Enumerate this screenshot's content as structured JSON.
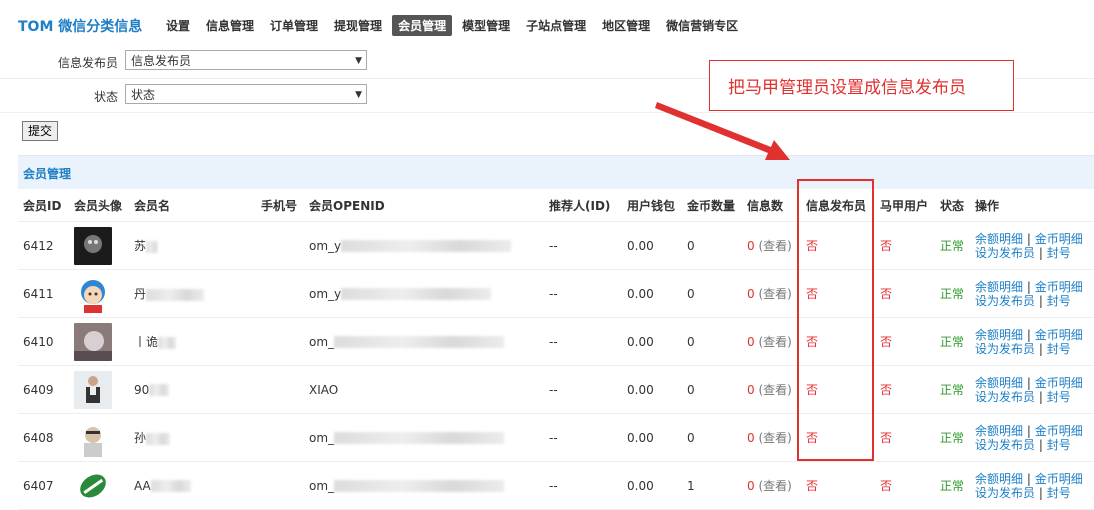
{
  "brand": "TOM 微信分类信息",
  "nav": [
    "设置",
    "信息管理",
    "订单管理",
    "提现管理",
    "会员管理",
    "模型管理",
    "子站点管理",
    "地区管理",
    "微信营销专区"
  ],
  "nav_active": "会员管理",
  "form": {
    "publisher_label": "信息发布员",
    "publisher_value": "信息发布员",
    "status_label": "状态",
    "status_value": "状态",
    "submit": "提交"
  },
  "section_title": "会员管理",
  "columns": [
    "会员ID",
    "会员头像",
    "会员名",
    "手机号",
    "会员OPENID",
    "推荐人(ID)",
    "用户钱包",
    "金币数量",
    "信息数",
    "信息发布员",
    "马甲用户",
    "状态",
    "操作"
  ],
  "rows": [
    {
      "id": "6412",
      "name": "苏",
      "phone": "",
      "openid": "om_y",
      "referrer": "--",
      "wallet": "0.00",
      "coins": "0",
      "info_count": "0",
      "view": "(查看)",
      "publisher": "否",
      "vest": "否",
      "status": "正常",
      "op1": "余额明细",
      "op2": "金币明细",
      "op3": "设为发布员",
      "op4": "封号"
    },
    {
      "id": "6411",
      "name": "丹",
      "phone": "",
      "openid": "om_y",
      "referrer": "--",
      "wallet": "0.00",
      "coins": "0",
      "info_count": "0",
      "view": "(查看)",
      "publisher": "否",
      "vest": "否",
      "status": "正常",
      "op1": "余额明细",
      "op2": "金币明细",
      "op3": "设为发布员",
      "op4": "封号"
    },
    {
      "id": "6410",
      "name": "丨诡",
      "phone": "",
      "openid": "om_",
      "referrer": "--",
      "wallet": "0.00",
      "coins": "0",
      "info_count": "0",
      "view": "(查看)",
      "publisher": "否",
      "vest": "否",
      "status": "正常",
      "op1": "余额明细",
      "op2": "金币明细",
      "op3": "设为发布员",
      "op4": "封号"
    },
    {
      "id": "6409",
      "name": "90",
      "phone": "",
      "openid": "XIAO",
      "referrer": "--",
      "wallet": "0.00",
      "coins": "0",
      "info_count": "0",
      "view": "(查看)",
      "publisher": "否",
      "vest": "否",
      "status": "正常",
      "op1": "余额明细",
      "op2": "金币明细",
      "op3": "设为发布员",
      "op4": "封号"
    },
    {
      "id": "6408",
      "name": "孙",
      "phone": "",
      "openid": "om_",
      "referrer": "--",
      "wallet": "0.00",
      "coins": "0",
      "info_count": "0",
      "view": "(查看)",
      "publisher": "否",
      "vest": "否",
      "status": "正常",
      "op1": "余额明细",
      "op2": "金币明细",
      "op3": "设为发布员",
      "op4": "封号"
    },
    {
      "id": "6407",
      "name": "AA",
      "phone": "",
      "openid": "om_",
      "referrer": "--",
      "wallet": "0.00",
      "coins": "1",
      "info_count": "0",
      "view": "(查看)",
      "publisher": "否",
      "vest": "否",
      "status": "正常",
      "op1": "余额明细",
      "op2": "金币明细",
      "op3": "设为发布员",
      "op4": "封号"
    }
  ],
  "annotation": "把马甲管理员设置成信息发布员",
  "colors": {
    "accent": "#1e7fc6",
    "red": "#e03030",
    "green": "#2b9a2b",
    "section_bg": "#eaf3fb"
  }
}
